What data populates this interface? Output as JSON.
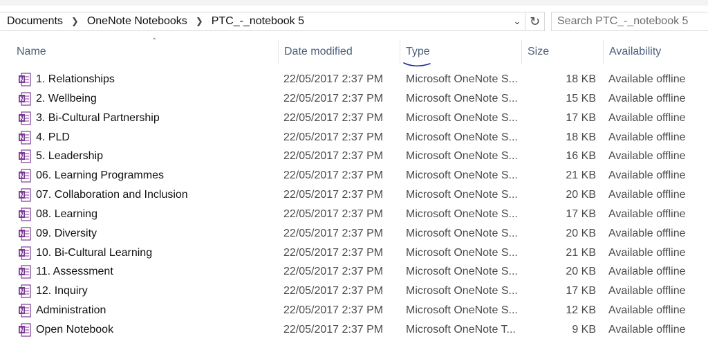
{
  "address_bar": {
    "breadcrumbs": [
      "Documents",
      "OneNote Notebooks",
      "PTC_-_notebook 5"
    ],
    "separator_icon": "chevron-right-icon"
  },
  "search": {
    "placeholder": "Search PTC_-_notebook 5"
  },
  "columns": {
    "name": "Name",
    "date": "Date modified",
    "type": "Type",
    "size": "Size",
    "availability": "Availability"
  },
  "files": [
    {
      "name": "1. Relationships",
      "date": "22/05/2017 2:37 PM",
      "type": "Microsoft OneNote S...",
      "size": "18 KB",
      "availability": "Available offline"
    },
    {
      "name": "2. Wellbeing",
      "date": "22/05/2017 2:37 PM",
      "type": "Microsoft OneNote S...",
      "size": "15 KB",
      "availability": "Available offline"
    },
    {
      "name": "3. Bi-Cultural Partnership",
      "date": "22/05/2017 2:37 PM",
      "type": "Microsoft OneNote S...",
      "size": "17 KB",
      "availability": "Available offline"
    },
    {
      "name": "4. PLD",
      "date": "22/05/2017 2:37 PM",
      "type": "Microsoft OneNote S...",
      "size": "18 KB",
      "availability": "Available offline"
    },
    {
      "name": "5. Leadership",
      "date": "22/05/2017 2:37 PM",
      "type": "Microsoft OneNote S...",
      "size": "16 KB",
      "availability": "Available offline"
    },
    {
      "name": "06. Learning Programmes",
      "date": "22/05/2017 2:37 PM",
      "type": "Microsoft OneNote S...",
      "size": "21 KB",
      "availability": "Available offline"
    },
    {
      "name": "07. Collaboration and Inclusion",
      "date": "22/05/2017 2:37 PM",
      "type": "Microsoft OneNote S...",
      "size": "20 KB",
      "availability": "Available offline"
    },
    {
      "name": "08. Learning",
      "date": "22/05/2017 2:37 PM",
      "type": "Microsoft OneNote S...",
      "size": "17 KB",
      "availability": "Available offline"
    },
    {
      "name": "09. Diversity",
      "date": "22/05/2017 2:37 PM",
      "type": "Microsoft OneNote S...",
      "size": "20 KB",
      "availability": "Available offline"
    },
    {
      "name": "10. Bi-Cultural Learning",
      "date": "22/05/2017 2:37 PM",
      "type": "Microsoft OneNote S...",
      "size": "21 KB",
      "availability": "Available offline"
    },
    {
      "name": "11. Assessment",
      "date": "22/05/2017 2:37 PM",
      "type": "Microsoft OneNote S...",
      "size": "20 KB",
      "availability": "Available offline"
    },
    {
      "name": "12. Inquiry",
      "date": "22/05/2017 2:37 PM",
      "type": "Microsoft OneNote S...",
      "size": "17 KB",
      "availability": "Available offline"
    },
    {
      "name": "Administration",
      "date": "22/05/2017 2:37 PM",
      "type": "Microsoft OneNote S...",
      "size": "12 KB",
      "availability": "Available offline"
    },
    {
      "name": "Open Notebook",
      "date": "22/05/2017 2:37 PM",
      "type": "Microsoft OneNote T...",
      "size": "9 KB",
      "availability": "Available offline"
    }
  ],
  "colors": {
    "onenote_purple": "#7b3a96",
    "header_text": "#4c607a",
    "annotation_blue": "#1a2a9c"
  }
}
